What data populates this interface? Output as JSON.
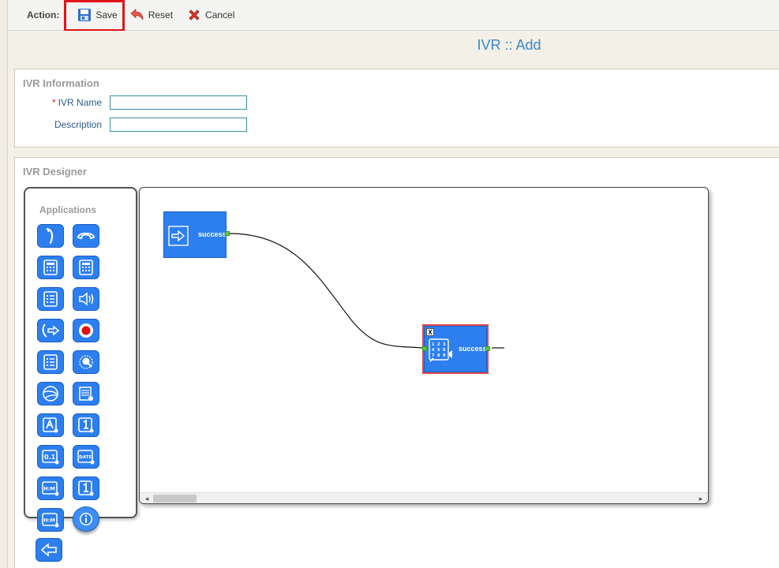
{
  "toolbar": {
    "action_label": "Action:",
    "save_label": "Save",
    "reset_label": "Reset",
    "cancel_label": "Cancel"
  },
  "page": {
    "title": "IVR :: Add"
  },
  "info_panel": {
    "title": "IVR Information",
    "fields": [
      {
        "label": "IVR Name",
        "required": "*",
        "value": ""
      },
      {
        "label": "Description",
        "required": "",
        "value": ""
      }
    ]
  },
  "designer_panel": {
    "title": "IVR Designer",
    "palette_title": "Applications",
    "icons": [
      "answer-icon",
      "hangup-icon",
      "calculator-icon",
      "calculator-alt-icon",
      "checklist-icon",
      "speaker-icon",
      "transfer-icon",
      "record-icon",
      "menu-icon",
      "speech-recognition-icon",
      "globe-icon",
      "schedule-icon",
      "say-alpha-icon",
      "say-digit-icon",
      "say-number-icon",
      "say-date-icon",
      "say-time-icon",
      "say-digit-alt-icon",
      "say-time-alt-icon",
      "info-icon",
      "back-arrow-icon"
    ],
    "nodes": [
      {
        "name": "start-node",
        "label": "success"
      },
      {
        "name": "keypad-node",
        "label": "success",
        "close": "X"
      }
    ]
  },
  "colors": {
    "accent": "#3e87c8",
    "node_blue": "#2d7ff0",
    "port_green": "#5dc73e",
    "highlight_red": "#e0141a"
  }
}
